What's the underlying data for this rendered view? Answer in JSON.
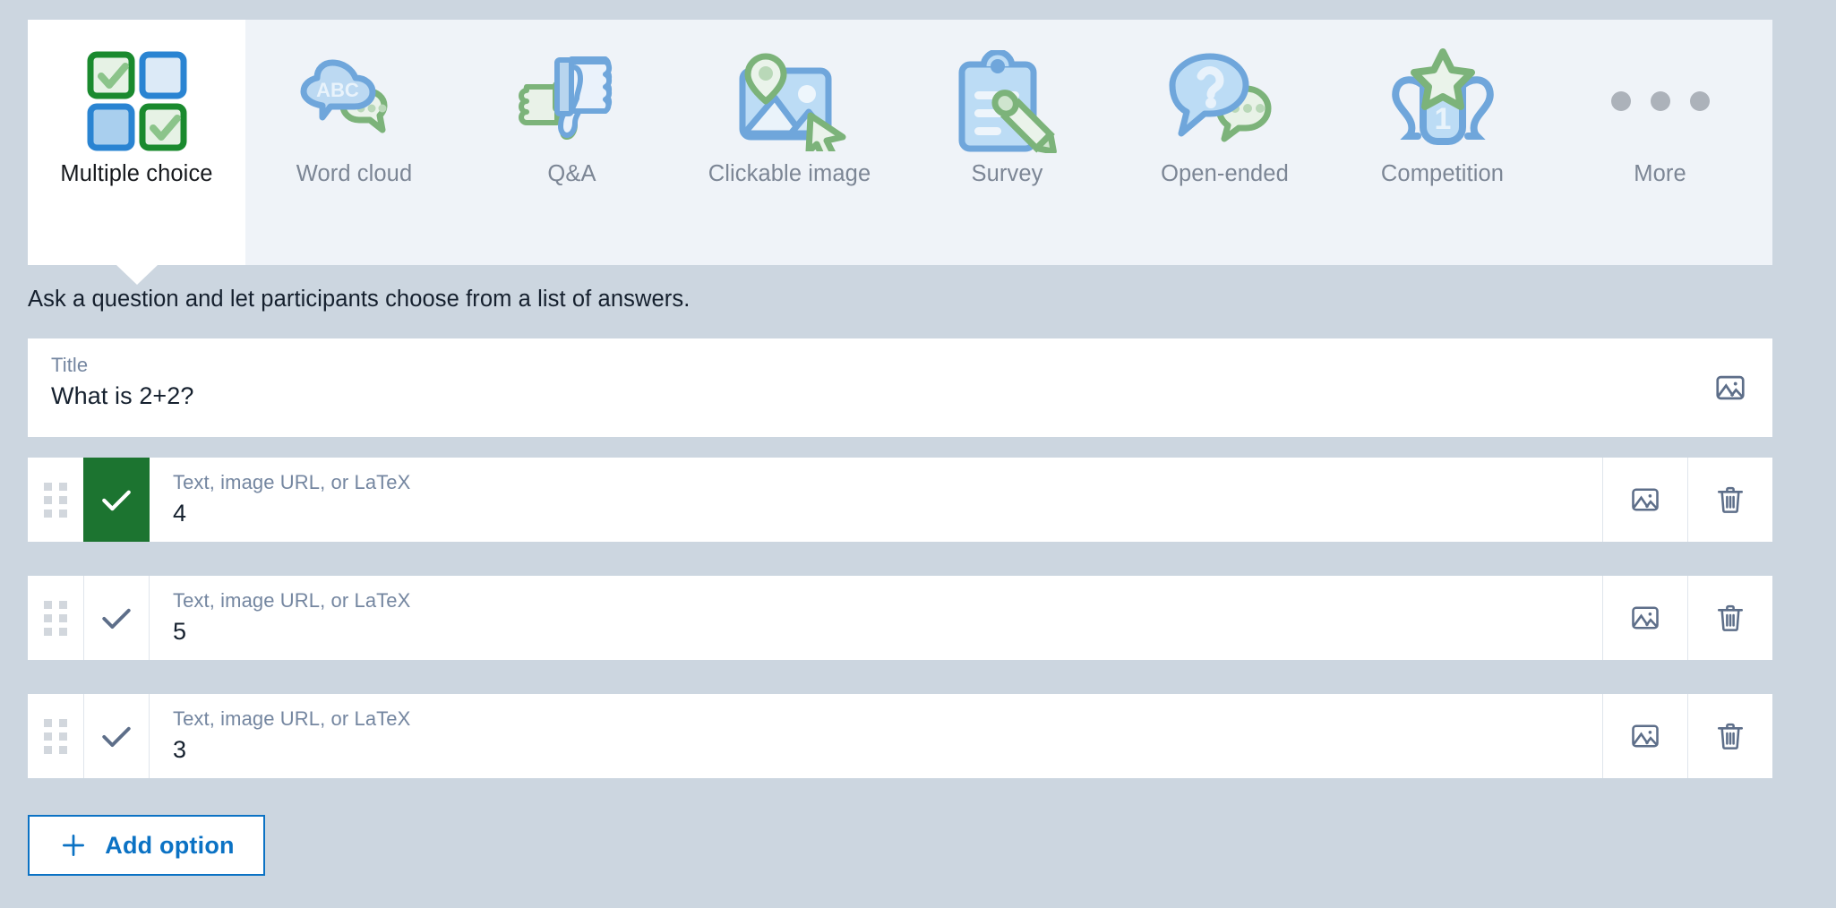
{
  "question_types": [
    {
      "label": "Multiple choice",
      "icon": "multiple-choice-icon",
      "active": true
    },
    {
      "label": "Word cloud",
      "icon": "word-cloud-icon",
      "active": false
    },
    {
      "label": "Q&A",
      "icon": "qa-thumbs-icon",
      "active": false
    },
    {
      "label": "Clickable image",
      "icon": "clickable-image-icon",
      "active": false
    },
    {
      "label": "Survey",
      "icon": "survey-clipboard-icon",
      "active": false
    },
    {
      "label": "Open-ended",
      "icon": "open-ended-icon",
      "active": false
    },
    {
      "label": "Competition",
      "icon": "competition-trophy-icon",
      "active": false
    },
    {
      "label": "More",
      "icon": "more-dots-icon",
      "active": false
    }
  ],
  "description": "Ask a question and let participants choose from a list of answers.",
  "title_field": {
    "label": "Title",
    "value": "What is 2+2?",
    "image_icon": "image-icon"
  },
  "options": [
    {
      "label": "Text, image URL, or LaTeX",
      "value": "4",
      "correct": true
    },
    {
      "label": "Text, image URL, or LaTeX",
      "value": "5",
      "correct": false
    },
    {
      "label": "Text, image URL, or LaTeX",
      "value": "3",
      "correct": false
    }
  ],
  "row_icons": {
    "image": "image-icon",
    "delete": "trash-icon",
    "drag": "drag-handle-icon",
    "check": "checkmark-icon"
  },
  "add_option": {
    "label": "Add option",
    "icon": "plus-icon"
  },
  "colors": {
    "page_bg": "#ccd6e0",
    "toolbar_bg": "#eff3f8",
    "card_bg": "#ffffff",
    "correct_green": "#1c7430",
    "accent_blue": "#0b72c4",
    "icon_blue": "#7aaade",
    "icon_green": "#7cb37a",
    "muted_text": "#7c8695",
    "label_text": "#7486a0",
    "body_text": "#15202e"
  }
}
